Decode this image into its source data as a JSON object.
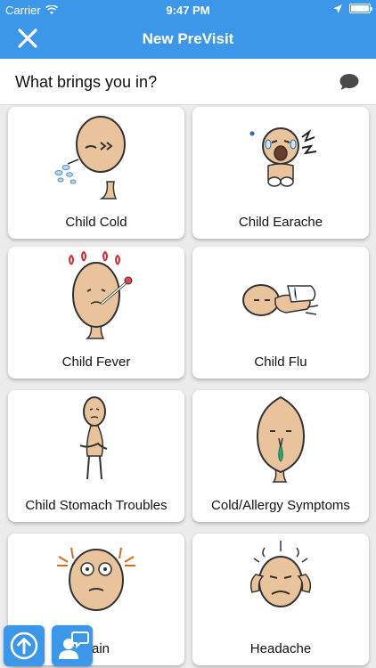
{
  "status_bar": {
    "carrier": "Carrier",
    "time": "9:47 PM",
    "battery_level": 1.0
  },
  "nav": {
    "title": "New PreVisit",
    "close_icon": "close-icon"
  },
  "question": {
    "text": "What brings you in?",
    "icon": "chat-bubble-icon"
  },
  "cards": [
    {
      "label": "Child Cold",
      "icon": "child-cold-illustration"
    },
    {
      "label": "Child Earache",
      "icon": "child-earache-illustration"
    },
    {
      "label": "Child Fever",
      "icon": "child-fever-illustration"
    },
    {
      "label": "Child Flu",
      "icon": "child-flu-illustration"
    },
    {
      "label": "Child Stomach Troubles",
      "icon": "child-stomach-illustration"
    },
    {
      "label": "Cold/Allergy Symptoms",
      "icon": "cold-allergy-illustration"
    },
    {
      "label": "Pain",
      "icon": "pain-illustration"
    },
    {
      "label": "Headache",
      "icon": "headache-illustration"
    }
  ],
  "floating_buttons": [
    {
      "icon": "upload-arrow-icon"
    },
    {
      "icon": "provider-chat-icon"
    }
  ],
  "colors": {
    "primary": "#3d97e8",
    "skin": "#e8c39c",
    "background": "#ececec"
  }
}
